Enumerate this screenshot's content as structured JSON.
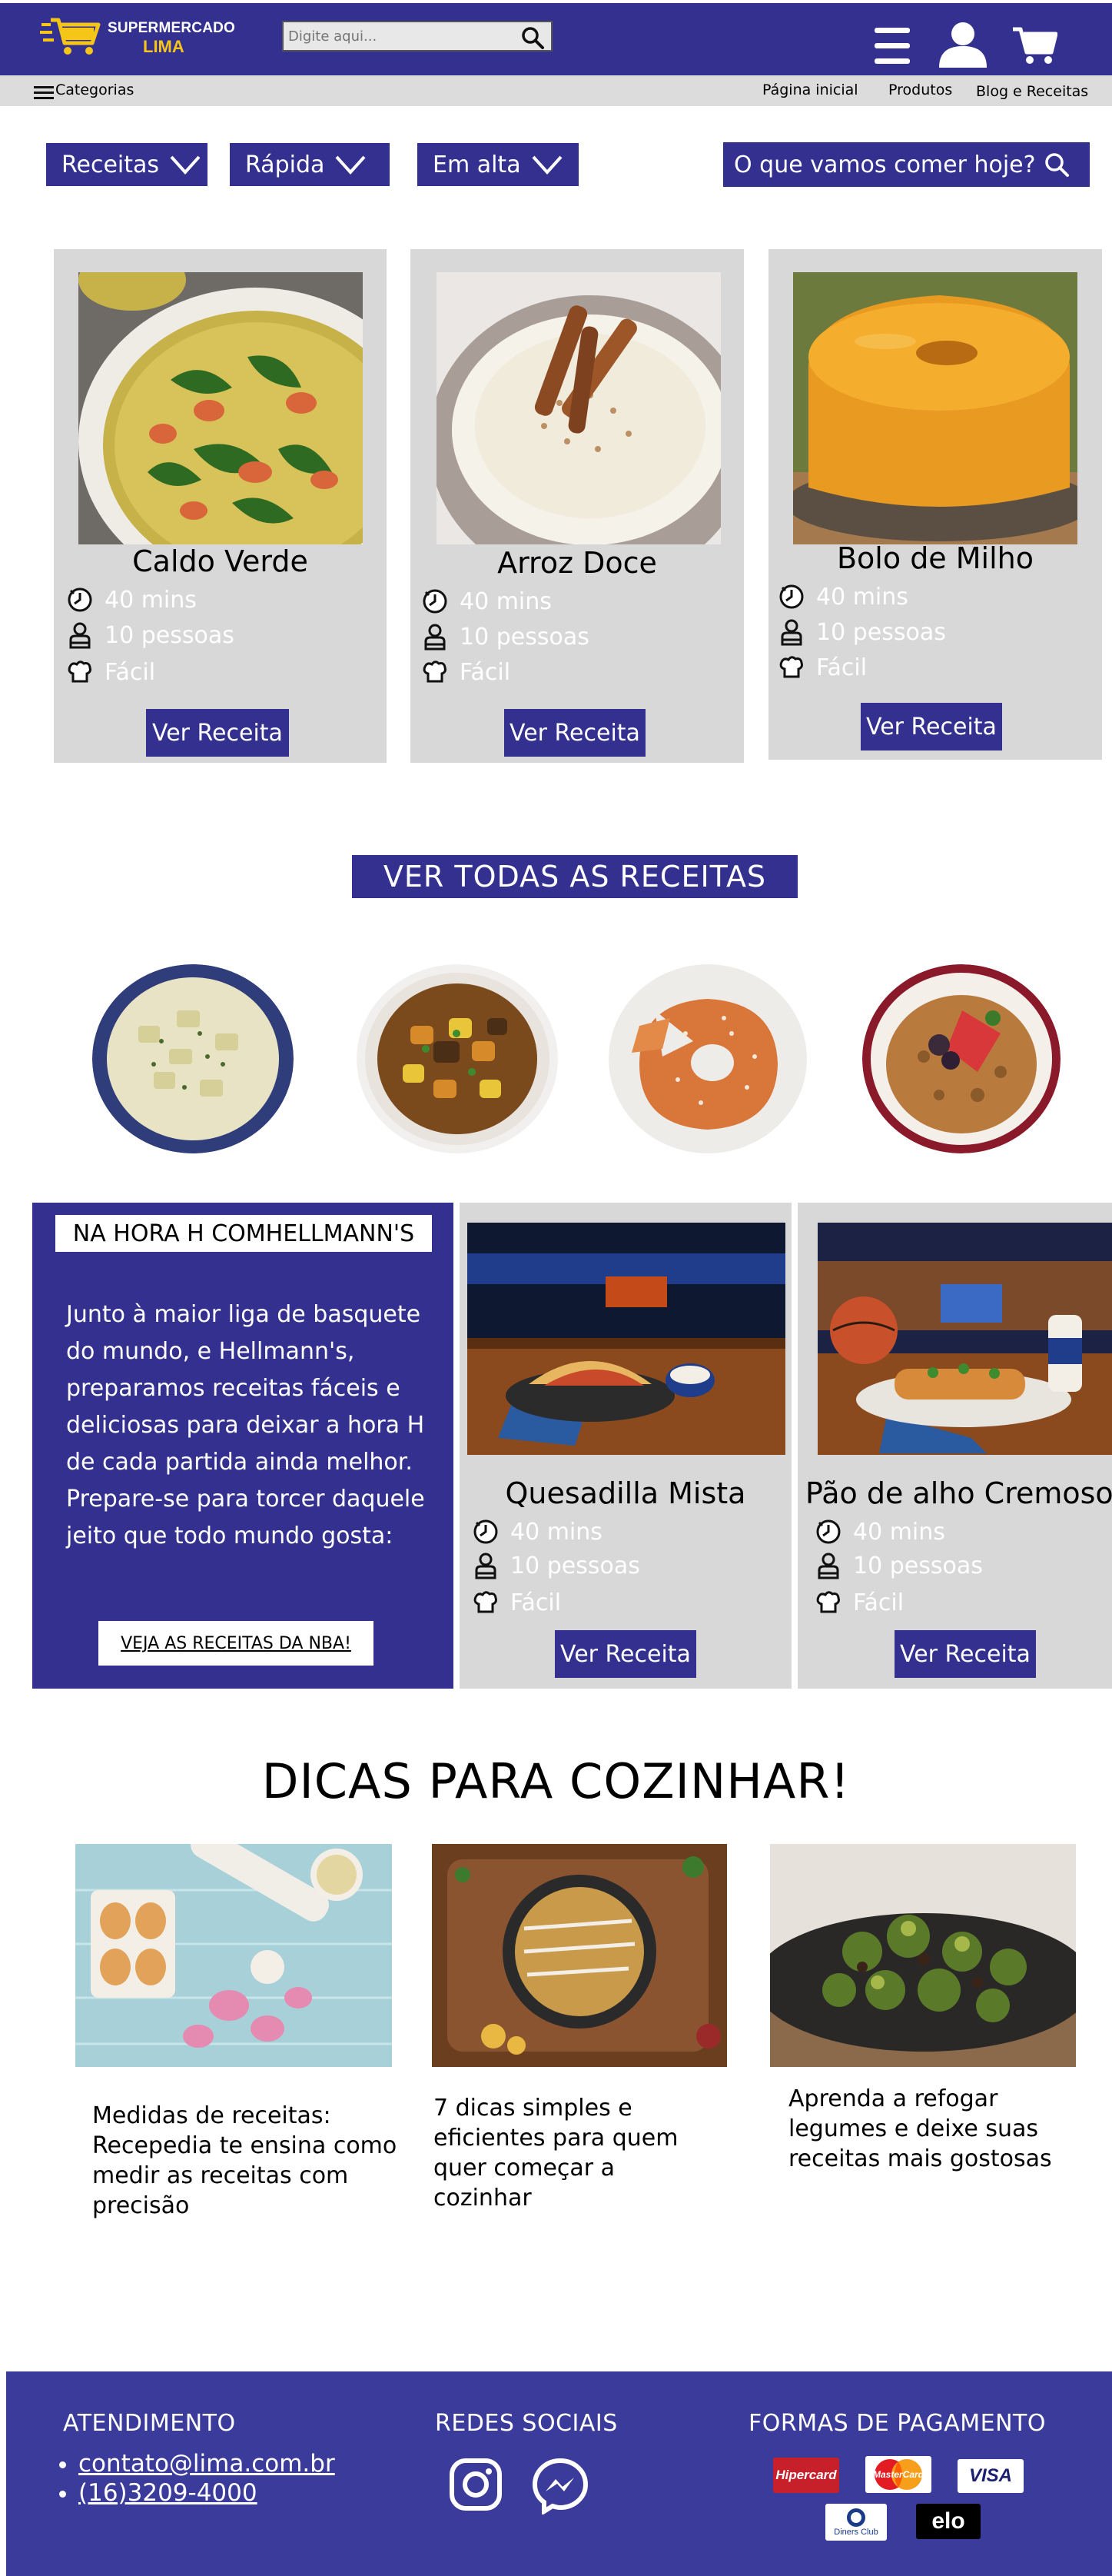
{
  "header": {
    "logo_line1": "SUPERMERCADO",
    "logo_line2": "LIMA",
    "search_placeholder": "Digite aqui..."
  },
  "subnav": {
    "categories_label": "Categorias",
    "links": [
      "Página inicial",
      "Produtos",
      "Blog e Receitas"
    ]
  },
  "filters": {
    "dropdowns": [
      "Receitas",
      "Rápida",
      "Em alta"
    ],
    "search_label": "O que vamos comer hoje?"
  },
  "recipes": [
    {
      "title": "Caldo Verde",
      "time": "40 mins",
      "servings": "10 pessoas",
      "difficulty": "Fácil",
      "button": "Ver Receita"
    },
    {
      "title": "Arroz Doce",
      "time": "40 mins",
      "servings": "10 pessoas",
      "difficulty": "Fácil",
      "button": "Ver Receita"
    },
    {
      "title": "Bolo de Milho",
      "time": "40 mins",
      "servings": "10 pessoas",
      "difficulty": "Fácil",
      "button": "Ver Receita"
    }
  ],
  "view_all_label": "VER TODAS AS RECEITAS",
  "promo": {
    "title": "NA HORA H COMHELLMANN'S",
    "text": "Junto à maior liga de basquete do mundo, e Hellmann's, preparamos receitas fáceis e deliciosas para deixar a hora H de cada partida ainda melhor. Prepare-se para torcer daquele jeito que todo mundo gosta:",
    "button": "VEJA AS RECEITAS DA NBA!",
    "recipes": [
      {
        "title": "Quesadilla Mista",
        "time": "40 mins",
        "servings": "10 pessoas",
        "difficulty": "Fácil",
        "button": "Ver Receita"
      },
      {
        "title": "Pão de alho Cremoso",
        "time": "40 mins",
        "servings": "10 pessoas",
        "difficulty": "Fácil",
        "button": "Ver Receita"
      }
    ]
  },
  "tips": {
    "title": "DICAS PARA COZINHAR!",
    "items": [
      "Medidas de receitas: Recepedia te ensina como medir as receitas com precisão",
      "7 dicas simples e eficientes para quem quer começar a cozinhar",
      "Aprenda a refogar legumes e deixe suas receitas mais gostosas"
    ]
  },
  "footer": {
    "atendimento_title": "ATENDIMENTO",
    "email": "contato@lima.com.br",
    "phone": "(16)3209-4000",
    "social_title": "REDES SOCIAIS",
    "payment_title": "FORMAS DE PAGAMENTO",
    "payment_methods": [
      "Hipercard",
      "MasterCard",
      "VISA",
      "Diners Club",
      "elo"
    ]
  },
  "colors": {
    "brand": "#333090",
    "footer": "#3b3b9b",
    "card": "#d8d8d8",
    "logo_yellow": "#f5c518"
  }
}
